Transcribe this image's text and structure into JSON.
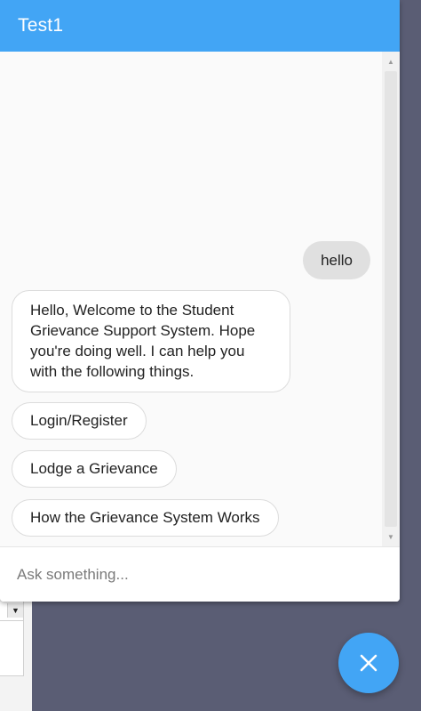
{
  "header": {
    "title": "Test1"
  },
  "messages": [
    {
      "sender": "user",
      "text": "hello"
    },
    {
      "sender": "bot",
      "text": "Hello, Welcome to the Student Grievance Support System. Hope you're doing well. I can help you with the following things."
    }
  ],
  "quick_replies": [
    {
      "label": "Login/Register"
    },
    {
      "label": "Lodge a Grievance"
    },
    {
      "label": "How the Grievance System Works"
    }
  ],
  "input": {
    "placeholder": "Ask something...",
    "value": ""
  },
  "fab": {
    "icon": "close-icon"
  },
  "colors": {
    "accent": "#42a5f5",
    "user_bubble": "#e0e0e0",
    "page_background": "#5a5d74"
  }
}
